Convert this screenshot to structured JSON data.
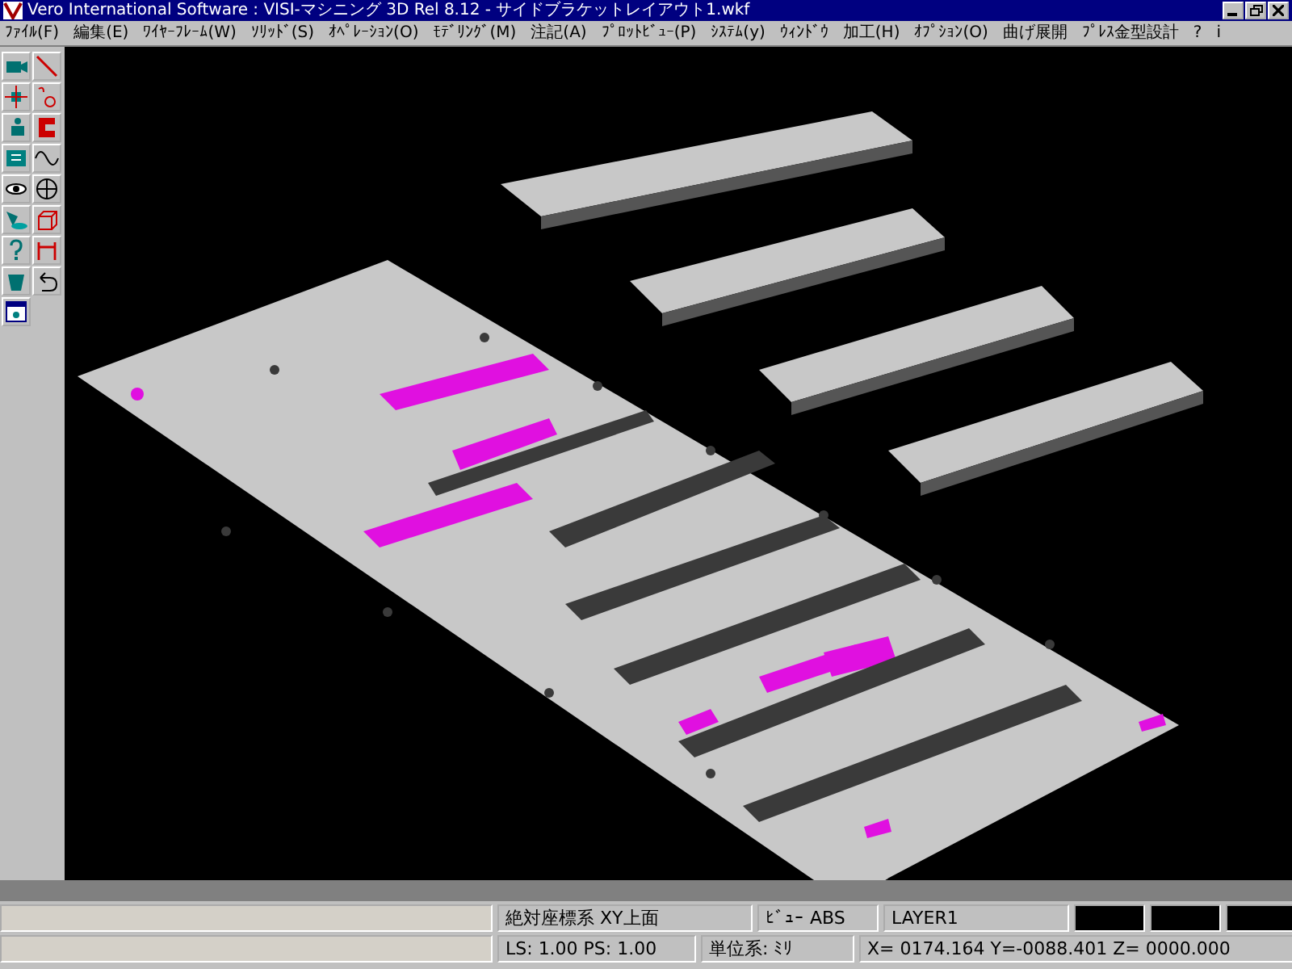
{
  "window": {
    "title": "Vero International Software : VISI-マシニング 3D Rel 8.12 - サイドブラケットレイアウト1.wkf"
  },
  "menu": [
    "ﾌｧｲﾙ(F)",
    "編集(E)",
    "ﾜｲﾔｰﾌﾚｰﾑ(W)",
    "ｿﾘｯﾄﾞ(S)",
    "ｵﾍﾟﾚｰｼｮﾝ(O)",
    "ﾓﾃﾞﾘﾝｸﾞ(M)",
    "注記(A)",
    "ﾌﾟﾛｯﾄﾋﾞｭｰ(P)",
    "ｼｽﾃﾑ(y)",
    "ｳｨﾝﾄﾞｳ",
    "加工(H)",
    "ｵﾌﾟｼｮﾝ(O)",
    "曲げ展開",
    "ﾌﾟﾚｽ金型設計",
    "?",
    "i"
  ],
  "status_bar": {
    "coordinate_system": "絶対座標系  XY上面",
    "view": "ﾋﾞｭｰ ABS",
    "layer": "LAYER1",
    "scale": "LS: 1.00 PS: 1.00",
    "units": "単位系: ﾐﾘ",
    "position": "X= 0174.164 Y=-0088.401 Z= 0000.000"
  }
}
